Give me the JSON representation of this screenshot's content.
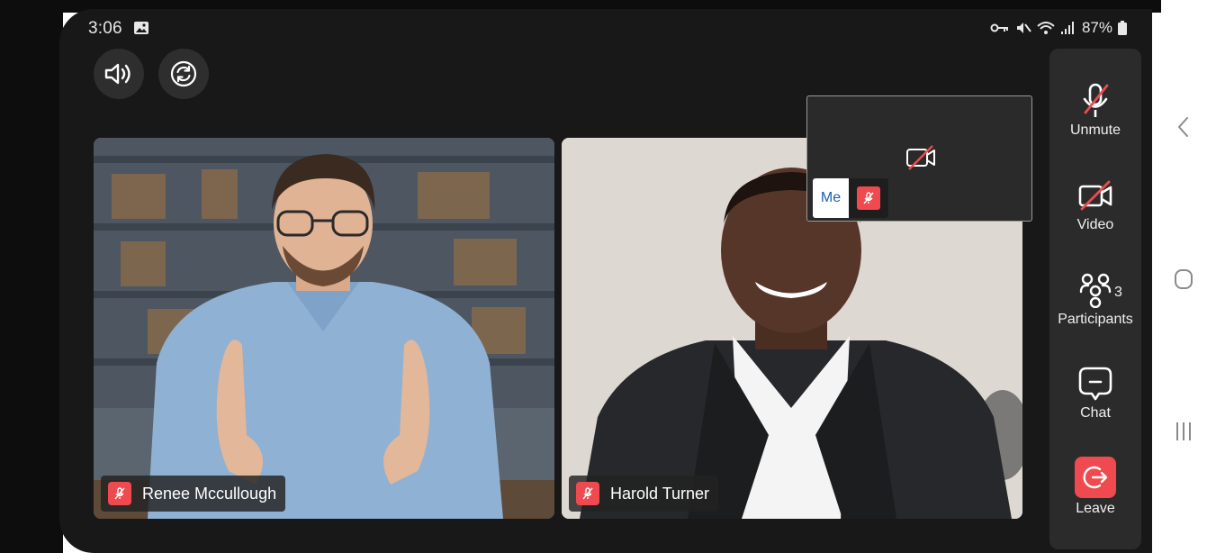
{
  "status_bar": {
    "time": "3:06",
    "battery": "87%",
    "icons": [
      "gallery-icon",
      "key-icon",
      "mute-icon",
      "wifi-icon",
      "signal-icon",
      "battery-icon"
    ]
  },
  "top_buttons": [
    "speaker-icon",
    "switch-camera-icon"
  ],
  "participants": [
    {
      "name": "Renee Mccullough",
      "muted": true
    },
    {
      "name": "Harold Turner",
      "muted": true
    }
  ],
  "self_view": {
    "label": "Me",
    "video_off": true,
    "muted": true
  },
  "controls": {
    "unmute": {
      "label": "Unmute",
      "icon": "mic-off-icon"
    },
    "video": {
      "label": "Video",
      "icon": "video-off-icon"
    },
    "participants": {
      "label": "Participants",
      "icon": "participants-icon",
      "count": "3"
    },
    "chat": {
      "label": "Chat",
      "icon": "chat-icon"
    },
    "leave": {
      "label": "Leave",
      "icon": "leave-icon",
      "color": "#ee4a4f"
    }
  },
  "system_nav": [
    "back-icon",
    "home-icon",
    "recents-icon"
  ],
  "colors": {
    "background": "#181818",
    "panel": "#2b2b2b",
    "danger": "#ee4a4f",
    "me_text": "#1a5fb4"
  }
}
